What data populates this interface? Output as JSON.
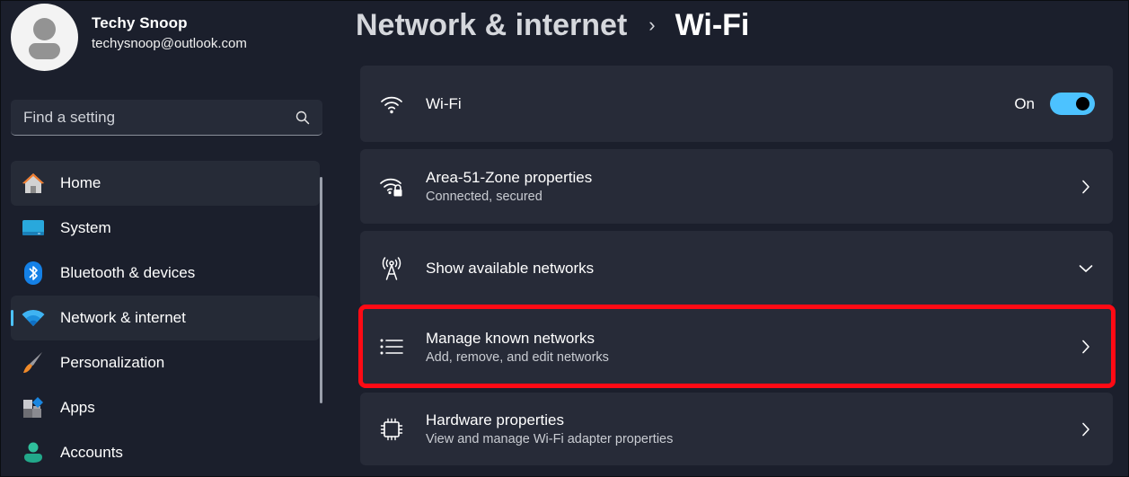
{
  "profile": {
    "name": "Techy Snoop",
    "email": "techysnoop@outlook.com"
  },
  "search": {
    "placeholder": "Find a setting",
    "value": ""
  },
  "sidebar": {
    "items": [
      {
        "label": "Home",
        "icon": "home-icon",
        "state": "hover"
      },
      {
        "label": "System",
        "icon": "system-icon",
        "state": ""
      },
      {
        "label": "Bluetooth & devices",
        "icon": "bluetooth-icon",
        "state": ""
      },
      {
        "label": "Network & internet",
        "icon": "network-icon",
        "state": "active"
      },
      {
        "label": "Personalization",
        "icon": "brush-icon",
        "state": ""
      },
      {
        "label": "Apps",
        "icon": "apps-icon",
        "state": ""
      },
      {
        "label": "Accounts",
        "icon": "accounts-icon",
        "state": ""
      }
    ]
  },
  "breadcrumb": {
    "parent": "Network & internet",
    "separator": "›",
    "current": "Wi-Fi"
  },
  "cards": {
    "wifi": {
      "title": "Wi-Fi",
      "toggle_label": "On",
      "toggle_on": true,
      "icon": "wifi-icon"
    },
    "properties": {
      "title": "Area-51-Zone properties",
      "subtitle": "Connected, secured",
      "icon": "wifi-lock-icon"
    },
    "available": {
      "title": "Show available networks",
      "icon": "antenna-icon"
    },
    "known": {
      "title": "Manage known networks",
      "subtitle": "Add, remove, and edit networks",
      "icon": "list-icon",
      "highlighted": true
    },
    "hardware": {
      "title": "Hardware properties",
      "subtitle": "View and manage Wi-Fi adapter properties",
      "icon": "chip-icon"
    }
  },
  "colors": {
    "accent": "#4cc2ff",
    "highlight": "#ff0a14",
    "background": "#1b1f2c",
    "card": "#272b38"
  }
}
